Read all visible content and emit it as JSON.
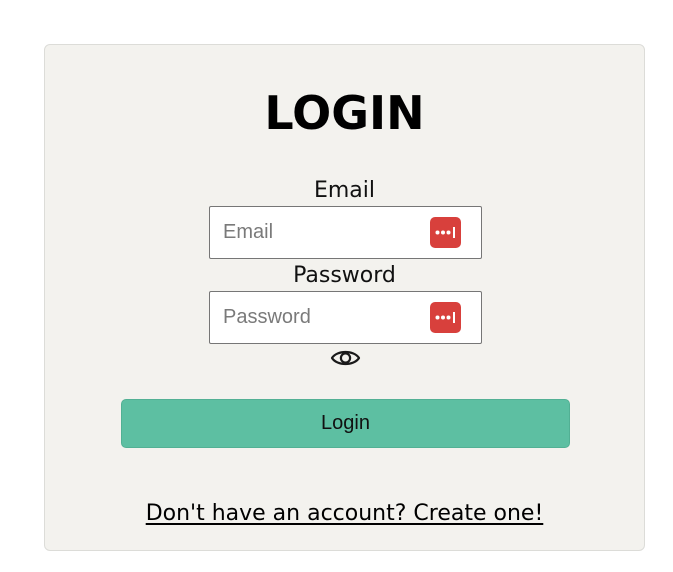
{
  "login_form": {
    "title": "LOGIN",
    "email": {
      "label": "Email",
      "placeholder": "Email",
      "value": ""
    },
    "password": {
      "label": "Password",
      "placeholder": "Password",
      "value": ""
    },
    "password_toggle_icon": "eye-icon",
    "password_manager_icon": "password-manager-icon",
    "submit_label": "Login",
    "signup_link_text": "Don't have an account? Create one!"
  },
  "colors": {
    "card_background": "#f3f2ee",
    "button_background": "#5dbfa2",
    "password_manager_icon": "#d8403c",
    "page_background": "#ffffff"
  }
}
